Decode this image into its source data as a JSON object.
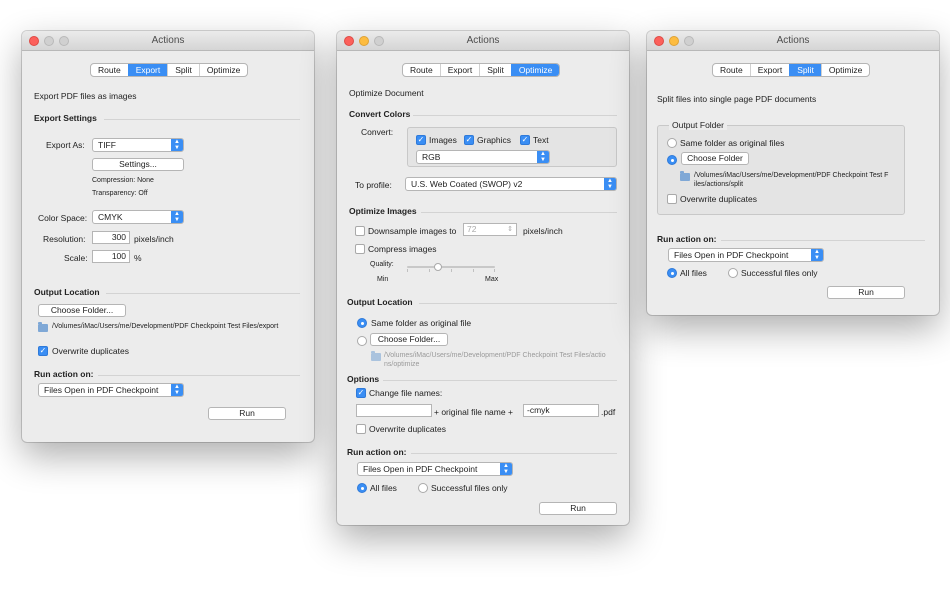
{
  "export": {
    "title": "Actions",
    "tabs": [
      "Route",
      "Export",
      "Split",
      "Optimize"
    ],
    "description": "Export PDF files as images",
    "settings_header": "Export Settings",
    "export_as_label": "Export As:",
    "export_as_value": "TIFF",
    "settings_button": "Settings...",
    "compression": "Compression: None",
    "transparency": "Transparency: Off",
    "color_space_label": "Color Space:",
    "color_space_value": "CMYK",
    "resolution_label": "Resolution:",
    "resolution_value": "300",
    "resolution_unit": "pixels/inch",
    "scale_label": "Scale:",
    "scale_value": "100",
    "scale_unit": "%",
    "output_header": "Output Location",
    "choose_folder": "Choose Folder...",
    "folder_path": "/Volumes/iMac/Users/me/Development/PDF Checkpoint Test Files/export",
    "overwrite": "Overwrite duplicates",
    "run_header": "Run action on:",
    "run_on_value": "Files Open in PDF Checkpoint",
    "run_button": "Run"
  },
  "optimize": {
    "title": "Actions",
    "tabs": [
      "Route",
      "Export",
      "Split",
      "Optimize"
    ],
    "description": "Optimize Document",
    "convert_header": "Convert Colors",
    "convert_label": "Convert:",
    "images": "Images",
    "graphics": "Graphics",
    "text": "Text",
    "color_value": "RGB",
    "profile_label": "To profile:",
    "profile_value": "U.S. Web Coated (SWOP) v2",
    "images_header": "Optimize Images",
    "downsample": "Downsample images to",
    "downsample_value": "72",
    "downsample_unit": "pixels/inch",
    "compress": "Compress images",
    "quality": "Quality:",
    "min": "Min",
    "max": "Max",
    "quality_level": 0.35,
    "output_header": "Output Location",
    "same_folder": "Same folder as original file",
    "choose_folder": "Choose Folder...",
    "folder_path_1": "/Volumes/iMac/Users/me/Development/PDF Checkpoint Test Files/actio",
    "folder_path_2": "ns/optimize",
    "options_header": "Options",
    "change_names": "Change file names:",
    "prefix_value": "",
    "original_name": "+ original file name +",
    "suffix_value": "-cmyk",
    "ext": ".pdf",
    "overwrite": "Overwrite duplicates",
    "run_header": "Run action on:",
    "run_on_value": "Files Open in PDF Checkpoint",
    "all_files": "All files",
    "successful": "Successful files only",
    "run_button": "Run"
  },
  "split": {
    "title": "Actions",
    "tabs": [
      "Route",
      "Export",
      "Split",
      "Optimize"
    ],
    "description": "Split files into single page PDF documents",
    "output_group": "Output Folder",
    "same_folder": "Same folder as original files",
    "choose_folder": "Choose Folder",
    "folder_path_1": "/Volumes/iMac/Users/me/Development/PDF Checkpoint Test F",
    "folder_path_2": "iles/actions/split",
    "overwrite": "Overwrite duplicates",
    "run_header": "Run action on:",
    "run_on_value": "Files Open in PDF Checkpoint",
    "all_files": "All files",
    "successful": "Successful files only",
    "run_button": "Run"
  },
  "colors": {
    "accent": "#3a8ef4",
    "window_bg": "#ececec"
  },
  "icons": [
    "close-light",
    "minimize-light",
    "zoom-light",
    "folder-icon",
    "checkmark-icon",
    "popup-arrows-icon"
  ]
}
